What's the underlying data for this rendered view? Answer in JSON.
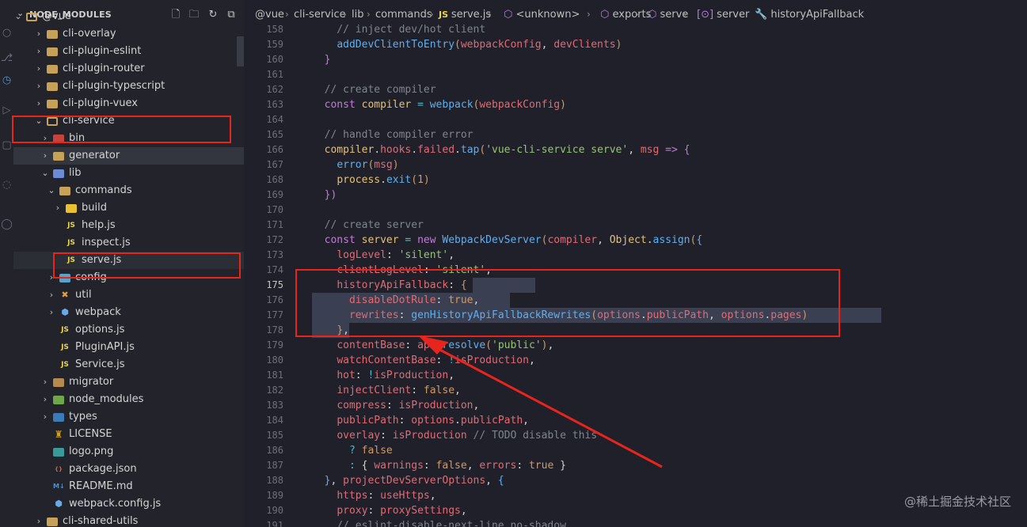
{
  "explorer": {
    "title": "NODE_MODULES",
    "actions": [
      "new-file-icon",
      "new-folder-icon",
      "refresh-icon",
      "collapse-all-icon"
    ],
    "items": [
      {
        "label": "@vue",
        "depth": 1,
        "kind": "folder-open",
        "expanded": true
      },
      {
        "label": "cli-overlay",
        "depth": 2,
        "kind": "folder",
        "expanded": false
      },
      {
        "label": "cli-plugin-eslint",
        "depth": 2,
        "kind": "folder",
        "expanded": false
      },
      {
        "label": "cli-plugin-router",
        "depth": 2,
        "kind": "folder",
        "expanded": false
      },
      {
        "label": "cli-plugin-typescript",
        "depth": 2,
        "kind": "folder",
        "expanded": false
      },
      {
        "label": "cli-plugin-vuex",
        "depth": 2,
        "kind": "folder",
        "expanded": false
      },
      {
        "label": "cli-service",
        "depth": 2,
        "kind": "folder-open",
        "expanded": true
      },
      {
        "label": "bin",
        "depth": 3,
        "kind": "bin",
        "expanded": false
      },
      {
        "label": "generator",
        "depth": 3,
        "kind": "folder",
        "expanded": false,
        "active": true
      },
      {
        "label": "lib",
        "depth": 3,
        "kind": "lib",
        "expanded": true
      },
      {
        "label": "commands",
        "depth": 4,
        "kind": "cmd",
        "expanded": true
      },
      {
        "label": "build",
        "depth": 5,
        "kind": "build",
        "expanded": false
      },
      {
        "label": "help.js",
        "depth": 5,
        "kind": "js"
      },
      {
        "label": "inspect.js",
        "depth": 5,
        "kind": "js"
      },
      {
        "label": "serve.js",
        "depth": 5,
        "kind": "js",
        "selected": true
      },
      {
        "label": "config",
        "depth": 4,
        "kind": "cfg",
        "expanded": false
      },
      {
        "label": "util",
        "depth": 4,
        "kind": "util",
        "expanded": false
      },
      {
        "label": "webpack",
        "depth": 4,
        "kind": "cube",
        "expanded": false
      },
      {
        "label": "options.js",
        "depth": 4,
        "kind": "js"
      },
      {
        "label": "PluginAPI.js",
        "depth": 4,
        "kind": "js"
      },
      {
        "label": "Service.js",
        "depth": 4,
        "kind": "js"
      },
      {
        "label": "migrator",
        "depth": 3,
        "kind": "mig",
        "expanded": false
      },
      {
        "label": "node_modules",
        "depth": 3,
        "kind": "nm",
        "expanded": false
      },
      {
        "label": "types",
        "depth": 3,
        "kind": "types",
        "expanded": false
      },
      {
        "label": "LICENSE",
        "depth": 3,
        "kind": "lic"
      },
      {
        "label": "logo.png",
        "depth": 3,
        "kind": "img"
      },
      {
        "label": "package.json",
        "depth": 3,
        "kind": "json"
      },
      {
        "label": "README.md",
        "depth": 3,
        "kind": "md"
      },
      {
        "label": "webpack.config.js",
        "depth": 3,
        "kind": "cube"
      },
      {
        "label": "cli-shared-utils",
        "depth": 2,
        "kind": "folder",
        "expanded": false
      }
    ]
  },
  "breadcrumb": [
    "@vue",
    "cli-service",
    "lib",
    "commands",
    "serve.js",
    "<unknown>",
    "exports",
    "serve",
    "server",
    "historyApiFallback"
  ],
  "editor": {
    "current_line": 175,
    "lines": [
      {
        "n": 158,
        "tokens": [
          [
            "c",
            "    // inject dev/hot client"
          ]
        ]
      },
      {
        "n": 159,
        "tokens": [
          [
            "w",
            "    "
          ],
          [
            "f",
            "addDevClientToEntry"
          ],
          [
            "br",
            "("
          ],
          [
            "v",
            "webpackConfig"
          ],
          [
            "w",
            ", "
          ],
          [
            "v",
            "devClients"
          ],
          [
            "br",
            ")"
          ]
        ]
      },
      {
        "n": 160,
        "tokens": [
          [
            "w",
            "  "
          ],
          [
            "pk",
            "}"
          ]
        ]
      },
      {
        "n": 161,
        "tokens": []
      },
      {
        "n": 162,
        "tokens": [
          [
            "c",
            "  // create compiler"
          ]
        ]
      },
      {
        "n": 163,
        "tokens": [
          [
            "w",
            "  "
          ],
          [
            "kw",
            "const "
          ],
          [
            "y",
            "compiler"
          ],
          [
            "w",
            " "
          ],
          [
            "o",
            "="
          ],
          [
            "w",
            " "
          ],
          [
            "f",
            "webpack"
          ],
          [
            "br",
            "("
          ],
          [
            "v",
            "webpackConfig"
          ],
          [
            "br",
            ")"
          ]
        ]
      },
      {
        "n": 164,
        "tokens": []
      },
      {
        "n": 165,
        "tokens": [
          [
            "c",
            "  // handle compiler error"
          ]
        ]
      },
      {
        "n": 166,
        "tokens": [
          [
            "w",
            "  "
          ],
          [
            "y",
            "compiler"
          ],
          [
            "w",
            "."
          ],
          [
            "v",
            "hooks"
          ],
          [
            "w",
            "."
          ],
          [
            "v",
            "failed"
          ],
          [
            "w",
            "."
          ],
          [
            "f",
            "tap"
          ],
          [
            "br",
            "("
          ],
          [
            "s",
            "'vue-cli-service serve'"
          ],
          [
            "w",
            ", "
          ],
          [
            "v",
            "msg"
          ],
          [
            "w",
            " "
          ],
          [
            "kw",
            "=>"
          ],
          [
            "w",
            " "
          ],
          [
            "pk",
            "{"
          ]
        ]
      },
      {
        "n": 167,
        "tokens": [
          [
            "w",
            "    "
          ],
          [
            "f",
            "error"
          ],
          [
            "br",
            "("
          ],
          [
            "v",
            "msg"
          ],
          [
            "br",
            ")"
          ]
        ]
      },
      {
        "n": 168,
        "tokens": [
          [
            "w",
            "    "
          ],
          [
            "y",
            "process"
          ],
          [
            "w",
            "."
          ],
          [
            "f",
            "exit"
          ],
          [
            "br",
            "("
          ],
          [
            "n",
            "1"
          ],
          [
            "br",
            ")"
          ]
        ]
      },
      {
        "n": 169,
        "tokens": [
          [
            "w",
            "  "
          ],
          [
            "pk",
            "})"
          ]
        ]
      },
      {
        "n": 170,
        "tokens": []
      },
      {
        "n": 171,
        "tokens": [
          [
            "c",
            "  // create server"
          ]
        ]
      },
      {
        "n": 172,
        "tokens": [
          [
            "w",
            "  "
          ],
          [
            "kw",
            "const "
          ],
          [
            "y",
            "server"
          ],
          [
            "w",
            " "
          ],
          [
            "o",
            "="
          ],
          [
            "w",
            " "
          ],
          [
            "kw",
            "new "
          ],
          [
            "f",
            "WebpackDevServer"
          ],
          [
            "br",
            "("
          ],
          [
            "v",
            "compiler"
          ],
          [
            "w",
            ", "
          ],
          [
            "y",
            "Object"
          ],
          [
            "w",
            "."
          ],
          [
            "f",
            "assign"
          ],
          [
            "br",
            "("
          ],
          [
            "k",
            "{"
          ]
        ]
      },
      {
        "n": 173,
        "tokens": [
          [
            "w",
            "    "
          ],
          [
            "pr",
            "logLevel"
          ],
          [
            "w",
            ": "
          ],
          [
            "s",
            "'silent'"
          ],
          [
            "w",
            ","
          ]
        ]
      },
      {
        "n": 174,
        "tokens": [
          [
            "w",
            "    "
          ],
          [
            "pr",
            "clientLogLevel"
          ],
          [
            "w",
            ": "
          ],
          [
            "s",
            "'silent'"
          ],
          [
            "w",
            ","
          ]
        ]
      },
      {
        "n": 175,
        "tokens": [
          [
            "w",
            "    "
          ],
          [
            "pr",
            "historyApiFallback"
          ],
          [
            "w",
            ": "
          ],
          [
            "n",
            "{"
          ]
        ]
      },
      {
        "n": 176,
        "tokens": [
          [
            "w",
            "      "
          ],
          [
            "pr",
            "disableDotRule"
          ],
          [
            "w",
            ": "
          ],
          [
            "n",
            "true"
          ],
          [
            "w",
            ","
          ]
        ]
      },
      {
        "n": 177,
        "tokens": [
          [
            "w",
            "      "
          ],
          [
            "pr",
            "rewrites"
          ],
          [
            "w",
            ": "
          ],
          [
            "f",
            "genHistoryApiFallbackRewrites"
          ],
          [
            "br",
            "("
          ],
          [
            "v",
            "options"
          ],
          [
            "w",
            "."
          ],
          [
            "pr",
            "publicPath"
          ],
          [
            "w",
            ", "
          ],
          [
            "v",
            "options"
          ],
          [
            "w",
            "."
          ],
          [
            "pr",
            "pages"
          ],
          [
            "br",
            ")"
          ]
        ]
      },
      {
        "n": 178,
        "tokens": [
          [
            "w",
            "    "
          ],
          [
            "n",
            "}"
          ],
          [
            "w",
            ","
          ]
        ]
      },
      {
        "n": 179,
        "tokens": [
          [
            "w",
            "    "
          ],
          [
            "pr",
            "contentBase"
          ],
          [
            "w",
            ": "
          ],
          [
            "v",
            "api"
          ],
          [
            "w",
            "."
          ],
          [
            "f",
            "resolve"
          ],
          [
            "br",
            "("
          ],
          [
            "s",
            "'public'"
          ],
          [
            "br",
            ")"
          ],
          [
            "w",
            ","
          ]
        ]
      },
      {
        "n": 180,
        "tokens": [
          [
            "w",
            "    "
          ],
          [
            "pr",
            "watchContentBase"
          ],
          [
            "w",
            ": "
          ],
          [
            "o",
            "!"
          ],
          [
            "v",
            "isProduction"
          ],
          [
            "w",
            ","
          ]
        ]
      },
      {
        "n": 181,
        "tokens": [
          [
            "w",
            "    "
          ],
          [
            "pr",
            "hot"
          ],
          [
            "w",
            ": "
          ],
          [
            "o",
            "!"
          ],
          [
            "v",
            "isProduction"
          ],
          [
            "w",
            ","
          ]
        ]
      },
      {
        "n": 182,
        "tokens": [
          [
            "w",
            "    "
          ],
          [
            "pr",
            "injectClient"
          ],
          [
            "w",
            ": "
          ],
          [
            "n",
            "false"
          ],
          [
            "w",
            ","
          ]
        ]
      },
      {
        "n": 183,
        "tokens": [
          [
            "w",
            "    "
          ],
          [
            "pr",
            "compress"
          ],
          [
            "w",
            ": "
          ],
          [
            "v",
            "isProduction"
          ],
          [
            "w",
            ","
          ]
        ]
      },
      {
        "n": 184,
        "tokens": [
          [
            "w",
            "    "
          ],
          [
            "pr",
            "publicPath"
          ],
          [
            "w",
            ": "
          ],
          [
            "v",
            "options"
          ],
          [
            "w",
            "."
          ],
          [
            "pr",
            "publicPath"
          ],
          [
            "w",
            ","
          ]
        ]
      },
      {
        "n": 185,
        "tokens": [
          [
            "w",
            "    "
          ],
          [
            "pr",
            "overlay"
          ],
          [
            "w",
            ": "
          ],
          [
            "v",
            "isProduction"
          ],
          [
            "w",
            " "
          ],
          [
            "c",
            "// TODO disable this"
          ]
        ]
      },
      {
        "n": 186,
        "tokens": [
          [
            "w",
            "      "
          ],
          [
            "o",
            "?"
          ],
          [
            "w",
            " "
          ],
          [
            "n",
            "false"
          ]
        ]
      },
      {
        "n": 187,
        "tokens": [
          [
            "w",
            "      "
          ],
          [
            "o",
            ":"
          ],
          [
            "w",
            " "
          ],
          [
            "w",
            "{ "
          ],
          [
            "pr",
            "warnings"
          ],
          [
            "w",
            ": "
          ],
          [
            "n",
            "false"
          ],
          [
            "w",
            ", "
          ],
          [
            "pr",
            "errors"
          ],
          [
            "w",
            ": "
          ],
          [
            "n",
            "true"
          ],
          [
            "w",
            " }"
          ]
        ]
      },
      {
        "n": 188,
        "tokens": [
          [
            "w",
            "  "
          ],
          [
            "k",
            "}"
          ],
          [
            "w",
            ", "
          ],
          [
            "v",
            "projectDevServerOptions"
          ],
          [
            "w",
            ", "
          ],
          [
            "k",
            "{"
          ]
        ]
      },
      {
        "n": 189,
        "tokens": [
          [
            "w",
            "    "
          ],
          [
            "pr",
            "https"
          ],
          [
            "w",
            ": "
          ],
          [
            "v",
            "useHttps"
          ],
          [
            "w",
            ","
          ]
        ]
      },
      {
        "n": 190,
        "tokens": [
          [
            "w",
            "    "
          ],
          [
            "pr",
            "proxy"
          ],
          [
            "w",
            ": "
          ],
          [
            "v",
            "proxySettings"
          ],
          [
            "w",
            ","
          ]
        ]
      },
      {
        "n": 191,
        "tokens": [
          [
            "c",
            "    // eslint-disable-next-line no-shadow"
          ]
        ]
      }
    ]
  },
  "watermark": "@稀土掘金技术社区",
  "colors": {
    "annotation": "#e8251c",
    "editor_bg": "#1f2029",
    "sidebar_bg": "#22232b"
  }
}
